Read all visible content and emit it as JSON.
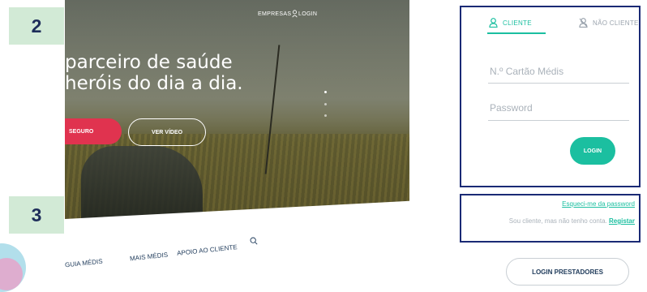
{
  "steps": {
    "two": "2",
    "three": "3"
  },
  "hero": {
    "line1": "parceiro de saúde",
    "line2": "heróis do dia a dia.",
    "nav_empresas": "EMPRESAS",
    "nav_login": "LOGIN",
    "seguro_label": "SEGURO",
    "video_label": "VER VÍDEO"
  },
  "menu": {
    "guia": "GUIA MÉDIS",
    "mais": "MAIS MÉDIS",
    "apoio": "APOIO AO CLIENTE"
  },
  "login": {
    "tab_cliente": "CLIENTE",
    "tab_nao_cliente": "NÃO CLIENTE",
    "card_placeholder": "N.º Cartão Médis",
    "password_placeholder": "Password",
    "login_button": "LOGIN"
  },
  "help": {
    "forgot_password": "Esqueci-me da password",
    "register_prefix": "Sou cliente, mas não tenho conta.",
    "register_link": "Registar"
  },
  "prestadores_button": "LOGIN PRESTADORES",
  "colors": {
    "accent": "#1bbfa0",
    "highlight_border": "#1a2a75",
    "badge_bg": "#d2ead6",
    "cta_red": "#e0334f"
  },
  "icons": {
    "user": "user-icon",
    "user_crossed": "user-crossed-icon",
    "search": "search-icon"
  }
}
